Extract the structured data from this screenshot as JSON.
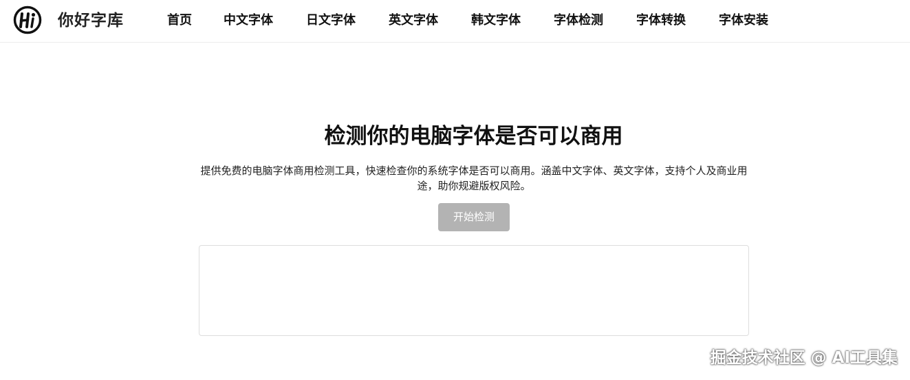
{
  "header": {
    "brand": "你好字库",
    "logo_icon": "hi-logo-icon",
    "nav": [
      {
        "label": "首页"
      },
      {
        "label": "中文字体"
      },
      {
        "label": "日文字体"
      },
      {
        "label": "英文字体"
      },
      {
        "label": "韩文字体"
      },
      {
        "label": "字体检测"
      },
      {
        "label": "字体转换"
      },
      {
        "label": "字体安装"
      }
    ]
  },
  "hero": {
    "title": "检测你的电脑字体是否可以商用",
    "description": "提供免费的电脑字体商用检测工具，快速检查你的系统字体是否可以商用。涵盖中文字体、英文字体，支持个人及商业用途，助你规避版权风险。",
    "start_button": "开始检测"
  },
  "result_box": {
    "content": ""
  },
  "watermark": "掘金技术社区 @ AI工具集",
  "colors": {
    "button_disabled": "#b3b3b3",
    "text": "#111111",
    "border": "#dddddd"
  }
}
